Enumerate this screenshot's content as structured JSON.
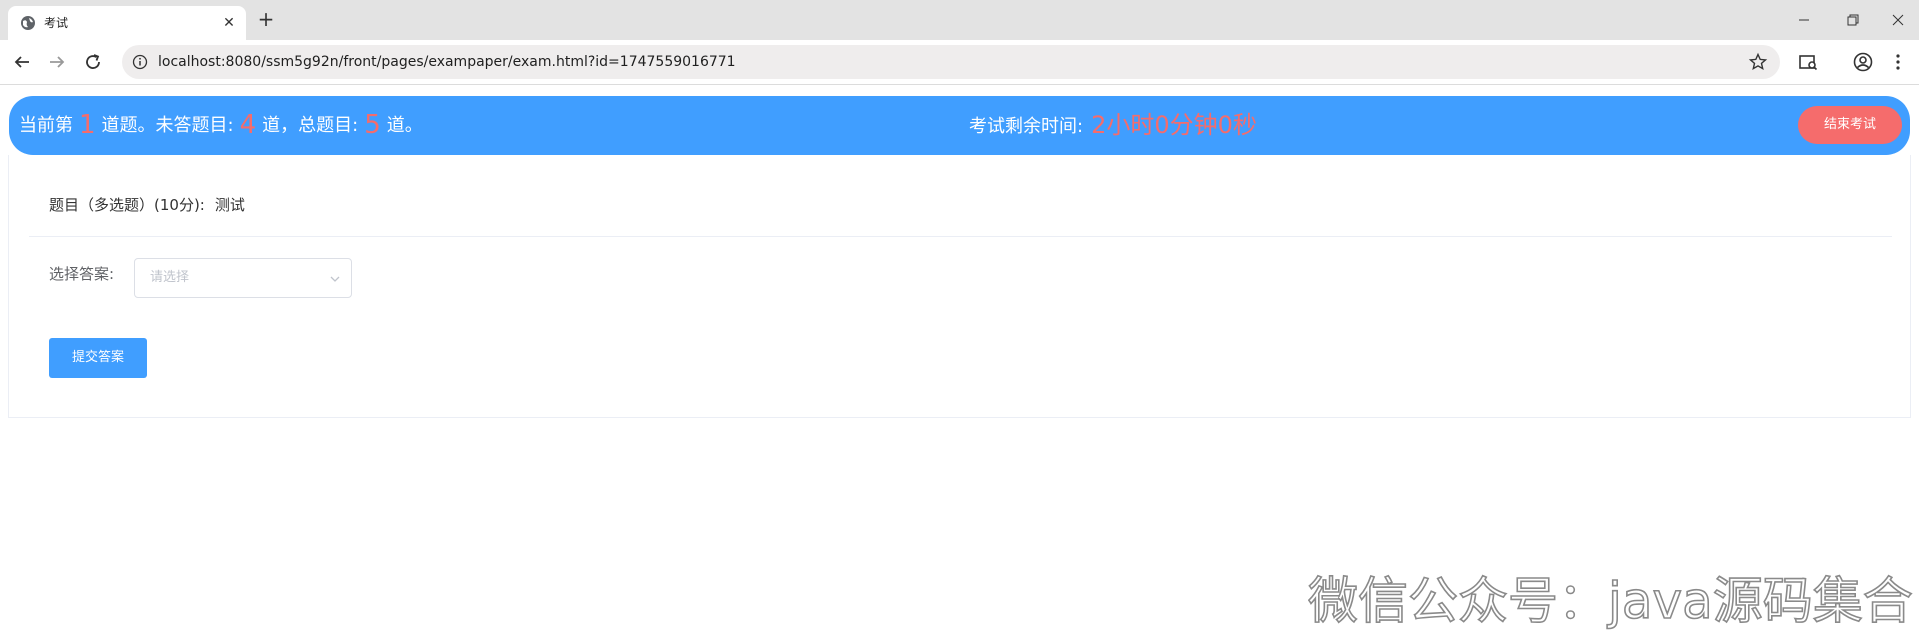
{
  "browser": {
    "tab_title": "考试",
    "url": "localhost:8080/ssm5g92n/front/pages/exampaper/exam.html?id=1747559016771",
    "new_tab_symbol": "+",
    "close_symbol": "✕"
  },
  "header": {
    "prefix": "当前第",
    "current": "1",
    "middle": "道题。未答题目:",
    "unanswered": "4",
    "middle2": "道，总题目:",
    "total": "5",
    "suffix": "道。",
    "timer_label": "考试剩余时间:",
    "timer_value": "2小时0分钟0秒",
    "end_button": "结束考试"
  },
  "question": {
    "type_label": "题目（多选题）(10分):",
    "title": "测试"
  },
  "answer": {
    "label": "选择答案:",
    "placeholder": "请选择"
  },
  "submit_button": "提交答案",
  "watermark": "微信公众号：java源码集合",
  "colors": {
    "primary": "#409eff",
    "danger": "#f56c6c",
    "tabbar": "#e3e3e3"
  },
  "icons": [
    "globe-icon",
    "close-icon",
    "plus-icon",
    "minimize-icon",
    "restore-icon",
    "window-close-icon",
    "back-icon",
    "forward-icon",
    "reload-icon",
    "site-info-icon",
    "star-icon",
    "search-tabs-icon",
    "profile-icon",
    "menu-icon",
    "chevron-down-icon"
  ]
}
